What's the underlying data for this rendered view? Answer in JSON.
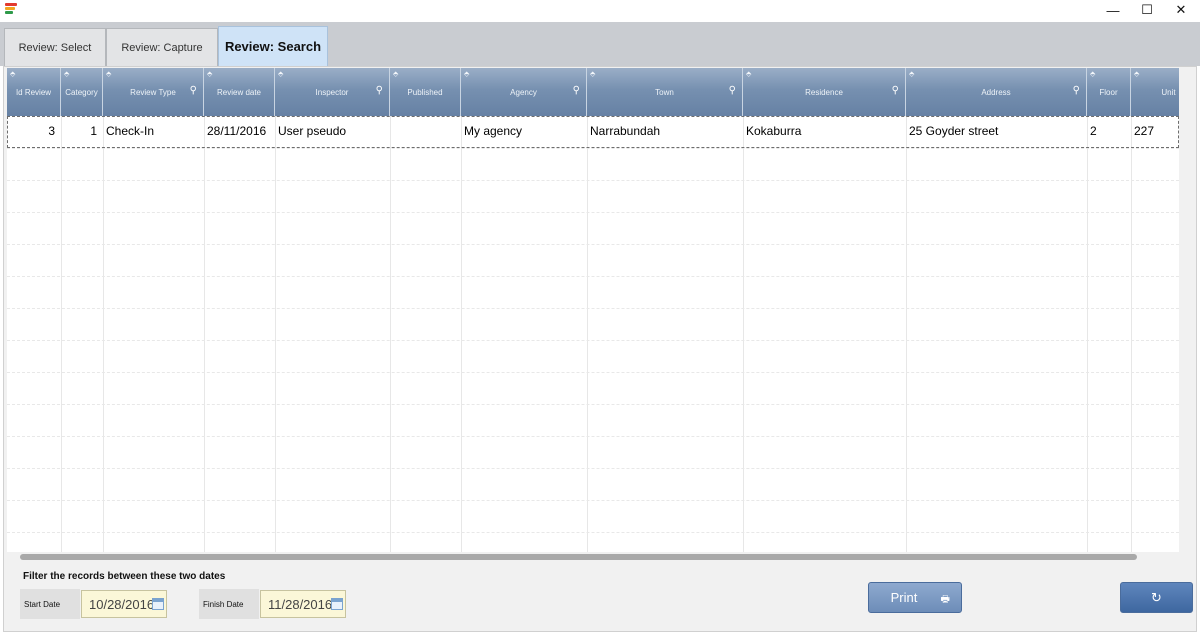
{
  "window": {
    "minimize_glyph": "—",
    "maximize_glyph": "☐",
    "close_glyph": "✕",
    "logo_colors": [
      "#e23a2e",
      "#f2a51f",
      "#2e9a4a",
      "#2d6cc6"
    ]
  },
  "tabs": [
    {
      "label": "Review: Select",
      "active": false
    },
    {
      "label": "Review: Capture",
      "active": false
    },
    {
      "label": "Review: Search",
      "active": true
    }
  ],
  "grid": {
    "columns": [
      {
        "label": "Id Review",
        "searchable": false
      },
      {
        "label": "Category",
        "searchable": false
      },
      {
        "label": "Review Type",
        "searchable": true
      },
      {
        "label": "Review date",
        "searchable": false
      },
      {
        "label": "Inspector",
        "searchable": true
      },
      {
        "label": "Published",
        "searchable": false
      },
      {
        "label": "Agency",
        "searchable": true
      },
      {
        "label": "Town",
        "searchable": true
      },
      {
        "label": "Residence",
        "searchable": true
      },
      {
        "label": "Address",
        "searchable": true
      },
      {
        "label": "Floor",
        "searchable": false
      },
      {
        "label": "Unit",
        "searchable": false
      }
    ],
    "sort_glyph": "⬘",
    "search_glyph": "⚲",
    "scroll_right_glyph": "▸",
    "rows": [
      [
        "3",
        "1",
        "Check-In",
        "28/11/2016",
        "User pseudo",
        "",
        "My agency",
        "Narrabundah",
        "Kokaburra",
        "25 Goyder street",
        "2",
        "227"
      ]
    ]
  },
  "filter": {
    "title": "Filter the records between these two dates",
    "start_label": "Start Date",
    "start_value": "10/28/2016",
    "finish_label": "Finish Date",
    "finish_value": "11/28/2016"
  },
  "buttons": {
    "print_label": "Print",
    "print_icon": "🖶",
    "refresh_icon": "↻"
  },
  "colors": {
    "header_top": "#9aaec7",
    "header_bottom": "#6681a4",
    "active_tab": "#cfe3f7",
    "date_field": "#fbf7d8",
    "button": "#5279ab"
  }
}
